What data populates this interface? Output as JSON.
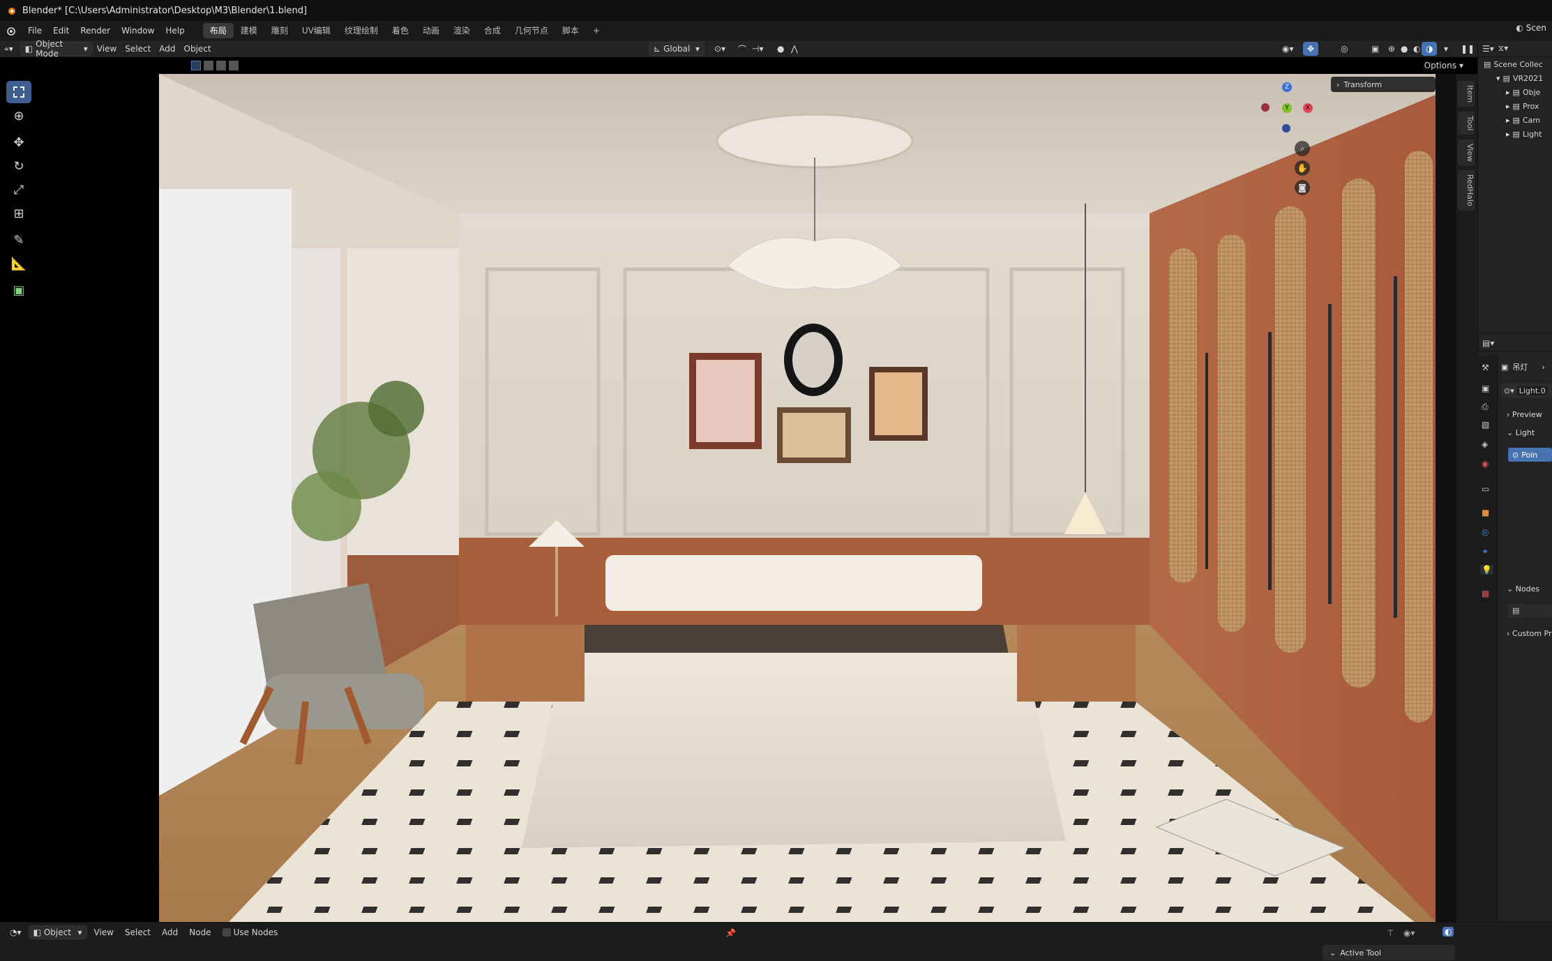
{
  "titlebar": {
    "title": "Blender* [C:\\Users\\Administrator\\Desktop\\M3\\Blender\\1.blend]"
  },
  "menu": {
    "items": [
      "File",
      "Edit",
      "Render",
      "Window",
      "Help"
    ],
    "workspaces": [
      "布局",
      "建模",
      "雕刻",
      "UV编辑",
      "纹理绘制",
      "着色",
      "动画",
      "渲染",
      "合成",
      "几何节点",
      "脚本"
    ],
    "add_tab": "+"
  },
  "viewport_header": {
    "mode": "Object Mode",
    "menus": [
      "View",
      "Select",
      "Add",
      "Object"
    ],
    "orientation": "Global",
    "options": "Options"
  },
  "viewport": {
    "transform_panel": "Transform",
    "gizmo_labels": {
      "z": "Z",
      "y": "Y",
      "x": "X"
    },
    "side_tabs": [
      "Item",
      "Tool",
      "View",
      "RedHalo"
    ]
  },
  "outliner": {
    "scene": "Scen",
    "collection": "Scene Collec",
    "root": "VR2021",
    "items": [
      "Obje",
      "Prox",
      "Cam",
      "Light"
    ]
  },
  "properties": {
    "object_name": "吊灯",
    "data_name": "Light.0",
    "sections": [
      "Preview",
      "Light",
      "Nodes",
      "Custom Pr"
    ],
    "light_type": "Poin"
  },
  "bottom_header": {
    "mode": "Object",
    "menus": [
      "View",
      "Select",
      "Add",
      "Node"
    ],
    "use_nodes": "Use Nodes",
    "active_tool": "Active Tool"
  },
  "colors": {
    "accent": "#4772b3",
    "active_tool": "#3f5d8f"
  }
}
